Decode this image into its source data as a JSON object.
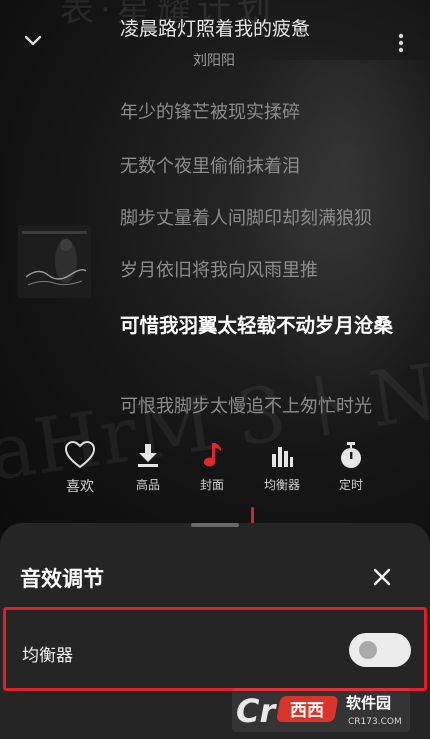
{
  "header": {
    "song_title": "凌晨路灯照着我的疲惫",
    "artist": "刘阳阳",
    "background_text": "表·星耀计划"
  },
  "lyrics": [
    "年少的锋芒被现实揉碎",
    "无数个夜里偷偷抹着泪",
    "脚步丈量着人间脚印却刻满狼狈",
    "岁月依旧将我向风雨里推",
    "可惜我羽翼太轻载不动岁月沧桑",
    "可恨我脚步太慢追不上匆忙时光"
  ],
  "current_lyric_index": 4,
  "actions": [
    {
      "id": "favorite",
      "label": "喜欢",
      "icon": "heart-outline-icon"
    },
    {
      "id": "quality",
      "label": "高品",
      "icon": "download-icon"
    },
    {
      "id": "cover",
      "label": "封面",
      "icon": "music-note-icon"
    },
    {
      "id": "equalizer",
      "label": "均衡器",
      "icon": "bar-chart-icon"
    },
    {
      "id": "timer",
      "label": "定时",
      "icon": "stopwatch-icon"
    }
  ],
  "sound_sheet": {
    "title": "音效调节",
    "equalizer_label": "均衡器",
    "equalizer_enabled": false
  },
  "colors": {
    "accent_red": "#e01f28",
    "highlight_frame": "#e01f28",
    "sheet_bg": "#252525"
  }
}
